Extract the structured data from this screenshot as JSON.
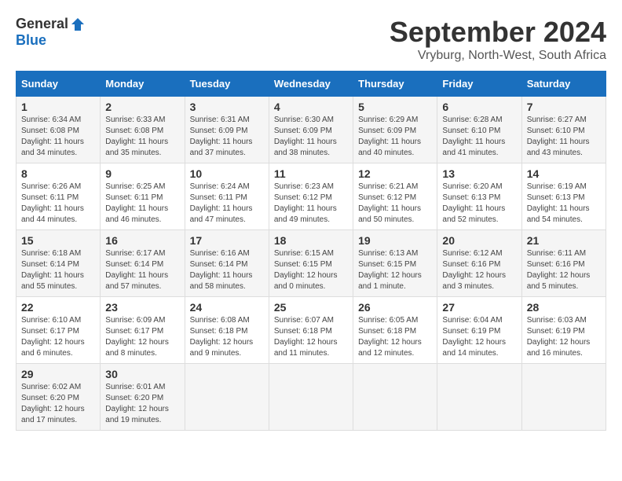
{
  "logo": {
    "general": "General",
    "blue": "Blue"
  },
  "title": "September 2024",
  "subtitle": "Vryburg, North-West, South Africa",
  "days_header": [
    "Sunday",
    "Monday",
    "Tuesday",
    "Wednesday",
    "Thursday",
    "Friday",
    "Saturday"
  ],
  "weeks": [
    [
      {
        "day": "1",
        "sunrise": "6:34 AM",
        "sunset": "6:08 PM",
        "daylight": "11 hours and 34 minutes."
      },
      {
        "day": "2",
        "sunrise": "6:33 AM",
        "sunset": "6:08 PM",
        "daylight": "11 hours and 35 minutes."
      },
      {
        "day": "3",
        "sunrise": "6:31 AM",
        "sunset": "6:09 PM",
        "daylight": "11 hours and 37 minutes."
      },
      {
        "day": "4",
        "sunrise": "6:30 AM",
        "sunset": "6:09 PM",
        "daylight": "11 hours and 38 minutes."
      },
      {
        "day": "5",
        "sunrise": "6:29 AM",
        "sunset": "6:09 PM",
        "daylight": "11 hours and 40 minutes."
      },
      {
        "day": "6",
        "sunrise": "6:28 AM",
        "sunset": "6:10 PM",
        "daylight": "11 hours and 41 minutes."
      },
      {
        "day": "7",
        "sunrise": "6:27 AM",
        "sunset": "6:10 PM",
        "daylight": "11 hours and 43 minutes."
      }
    ],
    [
      {
        "day": "8",
        "sunrise": "6:26 AM",
        "sunset": "6:11 PM",
        "daylight": "11 hours and 44 minutes."
      },
      {
        "day": "9",
        "sunrise": "6:25 AM",
        "sunset": "6:11 PM",
        "daylight": "11 hours and 46 minutes."
      },
      {
        "day": "10",
        "sunrise": "6:24 AM",
        "sunset": "6:11 PM",
        "daylight": "11 hours and 47 minutes."
      },
      {
        "day": "11",
        "sunrise": "6:23 AM",
        "sunset": "6:12 PM",
        "daylight": "11 hours and 49 minutes."
      },
      {
        "day": "12",
        "sunrise": "6:21 AM",
        "sunset": "6:12 PM",
        "daylight": "11 hours and 50 minutes."
      },
      {
        "day": "13",
        "sunrise": "6:20 AM",
        "sunset": "6:13 PM",
        "daylight": "11 hours and 52 minutes."
      },
      {
        "day": "14",
        "sunrise": "6:19 AM",
        "sunset": "6:13 PM",
        "daylight": "11 hours and 54 minutes."
      }
    ],
    [
      {
        "day": "15",
        "sunrise": "6:18 AM",
        "sunset": "6:14 PM",
        "daylight": "11 hours and 55 minutes."
      },
      {
        "day": "16",
        "sunrise": "6:17 AM",
        "sunset": "6:14 PM",
        "daylight": "11 hours and 57 minutes."
      },
      {
        "day": "17",
        "sunrise": "6:16 AM",
        "sunset": "6:14 PM",
        "daylight": "11 hours and 58 minutes."
      },
      {
        "day": "18",
        "sunrise": "6:15 AM",
        "sunset": "6:15 PM",
        "daylight": "12 hours and 0 minutes."
      },
      {
        "day": "19",
        "sunrise": "6:13 AM",
        "sunset": "6:15 PM",
        "daylight": "12 hours and 1 minute."
      },
      {
        "day": "20",
        "sunrise": "6:12 AM",
        "sunset": "6:16 PM",
        "daylight": "12 hours and 3 minutes."
      },
      {
        "day": "21",
        "sunrise": "6:11 AM",
        "sunset": "6:16 PM",
        "daylight": "12 hours and 5 minutes."
      }
    ],
    [
      {
        "day": "22",
        "sunrise": "6:10 AM",
        "sunset": "6:17 PM",
        "daylight": "12 hours and 6 minutes."
      },
      {
        "day": "23",
        "sunrise": "6:09 AM",
        "sunset": "6:17 PM",
        "daylight": "12 hours and 8 minutes."
      },
      {
        "day": "24",
        "sunrise": "6:08 AM",
        "sunset": "6:18 PM",
        "daylight": "12 hours and 9 minutes."
      },
      {
        "day": "25",
        "sunrise": "6:07 AM",
        "sunset": "6:18 PM",
        "daylight": "12 hours and 11 minutes."
      },
      {
        "day": "26",
        "sunrise": "6:05 AM",
        "sunset": "6:18 PM",
        "daylight": "12 hours and 12 minutes."
      },
      {
        "day": "27",
        "sunrise": "6:04 AM",
        "sunset": "6:19 PM",
        "daylight": "12 hours and 14 minutes."
      },
      {
        "day": "28",
        "sunrise": "6:03 AM",
        "sunset": "6:19 PM",
        "daylight": "12 hours and 16 minutes."
      }
    ],
    [
      {
        "day": "29",
        "sunrise": "6:02 AM",
        "sunset": "6:20 PM",
        "daylight": "12 hours and 17 minutes."
      },
      {
        "day": "30",
        "sunrise": "6:01 AM",
        "sunset": "6:20 PM",
        "daylight": "12 hours and 19 minutes."
      },
      null,
      null,
      null,
      null,
      null
    ]
  ]
}
